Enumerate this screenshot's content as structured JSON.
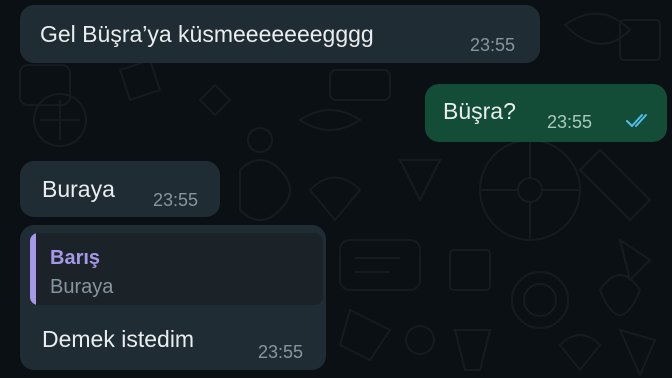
{
  "messages": [
    {
      "text": "Gel Büşra’ya küsmeeeeeeegggg",
      "time": "23:55",
      "direction": "incoming"
    },
    {
      "text": "Büşra?",
      "time": "23:55",
      "direction": "outgoing",
      "status_icon": "double-check-read-icon"
    },
    {
      "text": "Buraya",
      "time": "23:55",
      "direction": "incoming"
    },
    {
      "text": "Demek istedim",
      "time": "23:55",
      "direction": "incoming",
      "reply": {
        "sender": "Barış",
        "text": "Buraya"
      }
    }
  ],
  "colors": {
    "background": "#0b1014",
    "incoming_bubble": "#1f2c33",
    "outgoing_bubble": "#134d37",
    "read_ticks": "#53bdeb",
    "reply_accent": "#a797e8"
  }
}
